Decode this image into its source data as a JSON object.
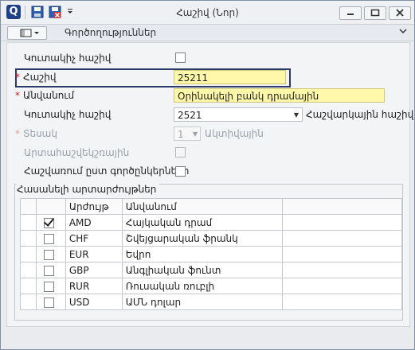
{
  "window": {
    "title": "Հաշիվ (Նոր)"
  },
  "ribbon": {
    "actions_label": "Գործողություններ"
  },
  "form": {
    "fields": [
      {
        "label": "Կուտակիչ հաշիվ",
        "checked": false
      },
      {
        "label": "Հաշիվ",
        "required": true,
        "value": "25211"
      },
      {
        "label": "Անվանում",
        "required": true,
        "value": "Օրինակելի բանկ դրամային"
      },
      {
        "label": "Կուտակիչ հաշիվ",
        "value": "2521",
        "suffix": "Հաշվարկային հաշիվ"
      },
      {
        "label": "Տեսակ",
        "required": true,
        "disabled": true,
        "value": "1",
        "suffix": "Ակտիվային"
      },
      {
        "label": "Արտահաշվեկշռային",
        "disabled": true,
        "checked": false
      },
      {
        "label": "Հաշվառում ըստ գործընկերների",
        "checked": false
      }
    ]
  },
  "currencies": {
    "title": "Հասանելի արտարժույթներ",
    "columns": [
      "",
      "Արժույթ",
      "Անվանում",
      ""
    ],
    "rows": [
      {
        "checked": true,
        "code": "AMD",
        "name": "Հայկական դրամ"
      },
      {
        "checked": false,
        "code": "CHF",
        "name": "Շվեյցարական ֆրանկ"
      },
      {
        "checked": false,
        "code": "EUR",
        "name": "Եվրո"
      },
      {
        "checked": false,
        "code": "GBP",
        "name": "Անգլիական ֆունտ"
      },
      {
        "checked": false,
        "code": "RUR",
        "name": "Ռուսական ռուբլի"
      },
      {
        "checked": false,
        "code": "USD",
        "name": "ԱՄՆ դոլար"
      }
    ]
  },
  "colors": {
    "required_star": "#d01e1e",
    "highlight_field": "#fff8a8",
    "focus_frame": "#2c3a6a"
  }
}
